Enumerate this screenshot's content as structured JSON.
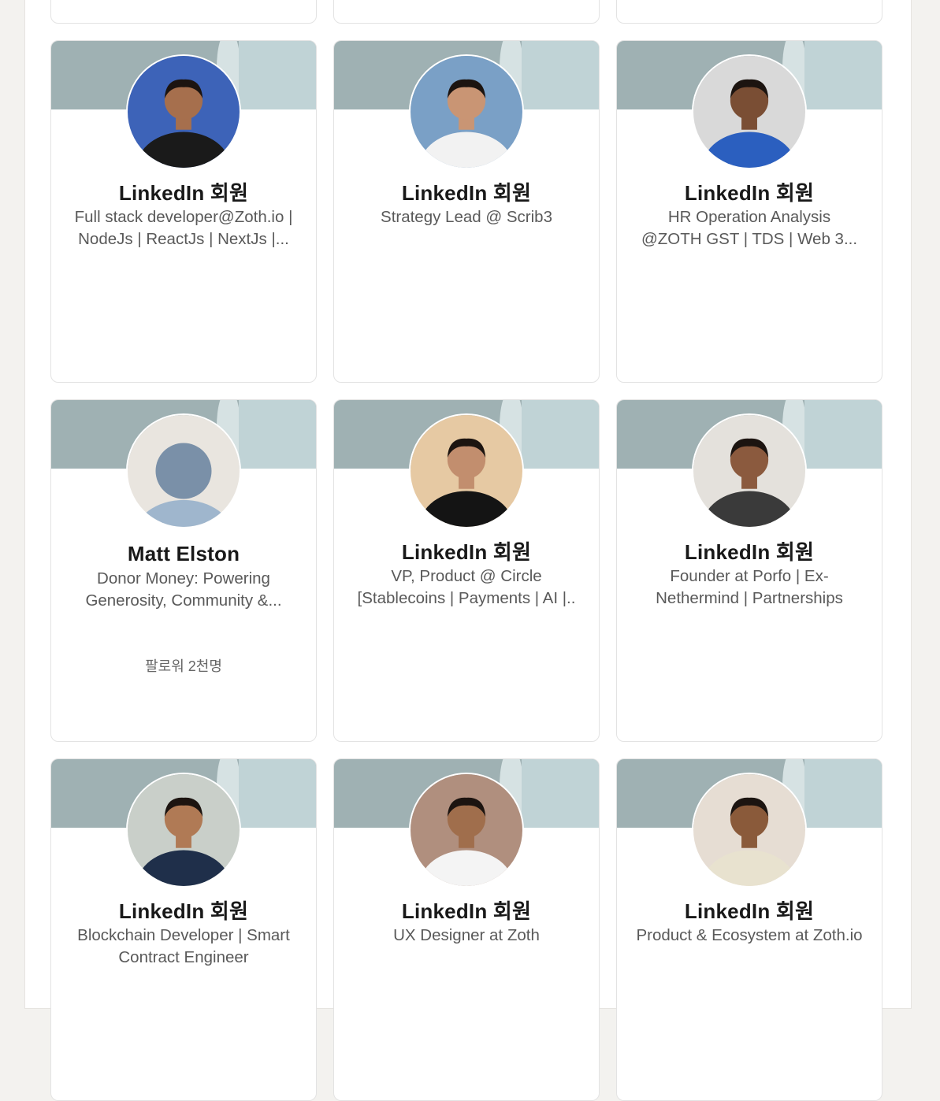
{
  "cards": [
    {
      "name": "LinkedIn 회원",
      "headline": "Full stack developer@Zoth.io | NodeJs | ReactJs | NextJs |...",
      "avatar_bg": "#3d63b8",
      "avatar_shirt": "#1a1a1a",
      "avatar_skin": "#a66f4d",
      "followers": ""
    },
    {
      "name": "LinkedIn 회원",
      "headline": "Strategy Lead @ Scrib3",
      "avatar_bg": "#7aa0c6",
      "avatar_shirt": "#f2f2f2",
      "avatar_skin": "#c99574",
      "followers": ""
    },
    {
      "name": "LinkedIn 회원",
      "headline": "HR Operation Analysis @ZOTH GST | TDS | Web 3...",
      "avatar_bg": "#d9d9d9",
      "avatar_shirt": "#2b5fbf",
      "avatar_skin": "#7a4e34",
      "followers": ""
    },
    {
      "name": "Matt Elston",
      "headline": "Donor Money: Powering Generosity, Community &...",
      "avatar_bg": "#e9e5df",
      "avatar_shirt": "#9fb6cd",
      "avatar_skin": "#7a90a8",
      "followers": "팔로워 2천명"
    },
    {
      "name": "LinkedIn 회원",
      "headline": "VP, Product @ Circle [Stablecoins | Payments | AI |..",
      "avatar_bg": "#e6c9a3",
      "avatar_shirt": "#141414",
      "avatar_skin": "#c28e6e",
      "followers": ""
    },
    {
      "name": "LinkedIn 회원",
      "headline": "Founder at Porfo | Ex-Nethermind | Partnerships",
      "avatar_bg": "#e4e1dc",
      "avatar_shirt": "#3a3a3a",
      "avatar_skin": "#8b5a3e",
      "followers": ""
    },
    {
      "name": "LinkedIn 회원",
      "headline": "Blockchain Developer | Smart Contract Engineer",
      "avatar_bg": "#c9cfc9",
      "avatar_shirt": "#1f2f4a",
      "avatar_skin": "#b07a55",
      "followers": ""
    },
    {
      "name": "LinkedIn 회원",
      "headline": "UX Designer at Zoth",
      "avatar_bg": "#b08f7e",
      "avatar_shirt": "#f4f4f4",
      "avatar_skin": "#a06e4c",
      "followers": ""
    },
    {
      "name": "LinkedIn 회원",
      "headline": "Product & Ecosystem at Zoth.io",
      "avatar_bg": "#e6ddd3",
      "avatar_shirt": "#e8e2cf",
      "avatar_skin": "#8a5a3a",
      "followers": ""
    }
  ]
}
